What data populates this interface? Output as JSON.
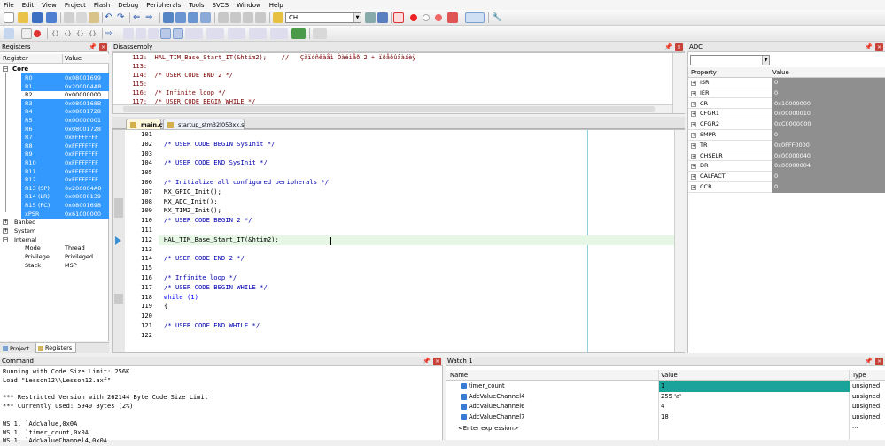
{
  "menubar": [
    "File",
    "Edit",
    "View",
    "Project",
    "Flash",
    "Debug",
    "Peripherals",
    "Tools",
    "SVCS",
    "Window",
    "Help"
  ],
  "toolbar": {
    "target_combo": "CH"
  },
  "registers": {
    "title": "Registers",
    "col_register": "Register",
    "col_value": "Value",
    "core_label": "Core",
    "rows": [
      {
        "name": "R0",
        "value": "0x08001699",
        "sel": true
      },
      {
        "name": "R1",
        "value": "0x200004A8",
        "sel": true
      },
      {
        "name": "R2",
        "value": "0x00000000",
        "sel": false
      },
      {
        "name": "R3",
        "value": "0x0800168B",
        "sel": true
      },
      {
        "name": "R4",
        "value": "0x08001728",
        "sel": true
      },
      {
        "name": "R5",
        "value": "0x00000001",
        "sel": true
      },
      {
        "name": "R6",
        "value": "0x08001728",
        "sel": true
      },
      {
        "name": "R7",
        "value": "0xFFFFFFFF",
        "sel": true
      },
      {
        "name": "R8",
        "value": "0xFFFFFFFF",
        "sel": true
      },
      {
        "name": "R9",
        "value": "0xFFFFFFFF",
        "sel": true
      },
      {
        "name": "R10",
        "value": "0xFFFFFFFF",
        "sel": true
      },
      {
        "name": "R11",
        "value": "0xFFFFFFFF",
        "sel": true
      },
      {
        "name": "R12",
        "value": "0xFFFFFFFF",
        "sel": true
      },
      {
        "name": "R13 (SP)",
        "value": "0x200004A8",
        "sel": true
      },
      {
        "name": "R14 (LR)",
        "value": "0x08000139",
        "sel": true
      },
      {
        "name": "R15 (PC)",
        "value": "0x08001698",
        "sel": true
      },
      {
        "name": "xPSR",
        "value": "0x61000000",
        "sel": true
      }
    ],
    "groups": [
      "Banked",
      "System",
      "Internal"
    ],
    "internal": [
      {
        "name": "Mode",
        "value": "Thread"
      },
      {
        "name": "Privilege",
        "value": "Privileged"
      },
      {
        "name": "Stack",
        "value": "MSP"
      }
    ],
    "tab_project": "Project",
    "tab_registers": "Registers"
  },
  "disassembly": {
    "title": "Disassembly",
    "lines": [
      {
        "num": "112:",
        "code": "HAL_TIM_Base_Start_IT(&htim2);    //   Çàïóñêàåì Òàéìåð 2 + ïðåðûâàíèÿ"
      },
      {
        "num": "113:",
        "code": ""
      },
      {
        "num": "114:",
        "code": "/* USER CODE END 2 */"
      },
      {
        "num": "115:",
        "code": ""
      },
      {
        "num": "116:",
        "code": "/* Infinite loop */"
      },
      {
        "num": "117:",
        "code": "/* USER CODE BEGIN WHILE */"
      }
    ]
  },
  "editor": {
    "tabs": [
      "main.c*",
      "startup_stm32l053xx.s"
    ],
    "lines": [
      {
        "num": "101",
        "code": ""
      },
      {
        "num": "102",
        "code": "/* USER CODE BEGIN SysInit */"
      },
      {
        "num": "103",
        "code": ""
      },
      {
        "num": "104",
        "code": "/* USER CODE END SysInit */"
      },
      {
        "num": "105",
        "code": ""
      },
      {
        "num": "106",
        "code": "/* Initialize all configured peripherals */"
      },
      {
        "num": "107",
        "code": "MX_GPIO_Init();"
      },
      {
        "num": "108",
        "code": "MX_ADC_Init();"
      },
      {
        "num": "109",
        "code": "MX_TIM2_Init();"
      },
      {
        "num": "110",
        "code": "/* USER CODE BEGIN 2 */"
      },
      {
        "num": "111",
        "code": ""
      },
      {
        "num": "112",
        "code": "HAL_TIM_Base_Start_IT(&htim2);"
      },
      {
        "num": "113",
        "code": ""
      },
      {
        "num": "114",
        "code": "/* USER CODE END 2 */"
      },
      {
        "num": "115",
        "code": ""
      },
      {
        "num": "116",
        "code": "/* Infinite loop */"
      },
      {
        "num": "117",
        "code": "/* USER CODE BEGIN WHILE */"
      },
      {
        "num": "118",
        "code": "while (1)"
      },
      {
        "num": "119",
        "code": "{"
      },
      {
        "num": "120",
        "code": ""
      },
      {
        "num": "121",
        "code": "/* USER CODE END WHILE */"
      },
      {
        "num": "122",
        "code": ""
      }
    ]
  },
  "adc": {
    "title": "ADC",
    "col_property": "Property",
    "col_value": "Value",
    "rows": [
      {
        "name": "ISR",
        "value": "0"
      },
      {
        "name": "IER",
        "value": "0"
      },
      {
        "name": "CR",
        "value": "0x10000000"
      },
      {
        "name": "CFGR1",
        "value": "0x00000010"
      },
      {
        "name": "CFGR2",
        "value": "0xC0000000"
      },
      {
        "name": "SMPR",
        "value": "0"
      },
      {
        "name": "TR",
        "value": "0x0FFF0000"
      },
      {
        "name": "CHSELR",
        "value": "0x00000040"
      },
      {
        "name": "DR",
        "value": "0x00000004"
      },
      {
        "name": "CALFACT",
        "value": "0"
      },
      {
        "name": "CCR",
        "value": "0"
      }
    ]
  },
  "command": {
    "title": "Command",
    "lines": [
      "Running with Code Size Limit: 256K",
      "Load \"Lesson12\\\\Lesson12.axf\"",
      "",
      "*** Restricted Version with 262144 Byte Code Size Limit",
      "*** Currently used: 5940 Bytes (2%)",
      "",
      "WS 1, `AdcValue,0x0A",
      "WS 1, `timer_count,0x0A",
      "WS 1, `AdcValueChannel4,0x0A"
    ]
  },
  "watch": {
    "title": "Watch 1",
    "col_name": "Name",
    "col_value": "Value",
    "col_type": "Type",
    "rows": [
      {
        "name": "timer_count",
        "value": "1",
        "type": "unsigned ..."
      },
      {
        "name": "AdcValueChannel4",
        "value": "255 'a'",
        "type": "unsigned ..."
      },
      {
        "name": "AdcValueChannel6",
        "value": "4",
        "type": "unsigned ..."
      },
      {
        "name": "AdcValueChannel7",
        "value": "18",
        "type": "unsigned ..."
      }
    ],
    "enter_expr": "<Enter expression>"
  }
}
